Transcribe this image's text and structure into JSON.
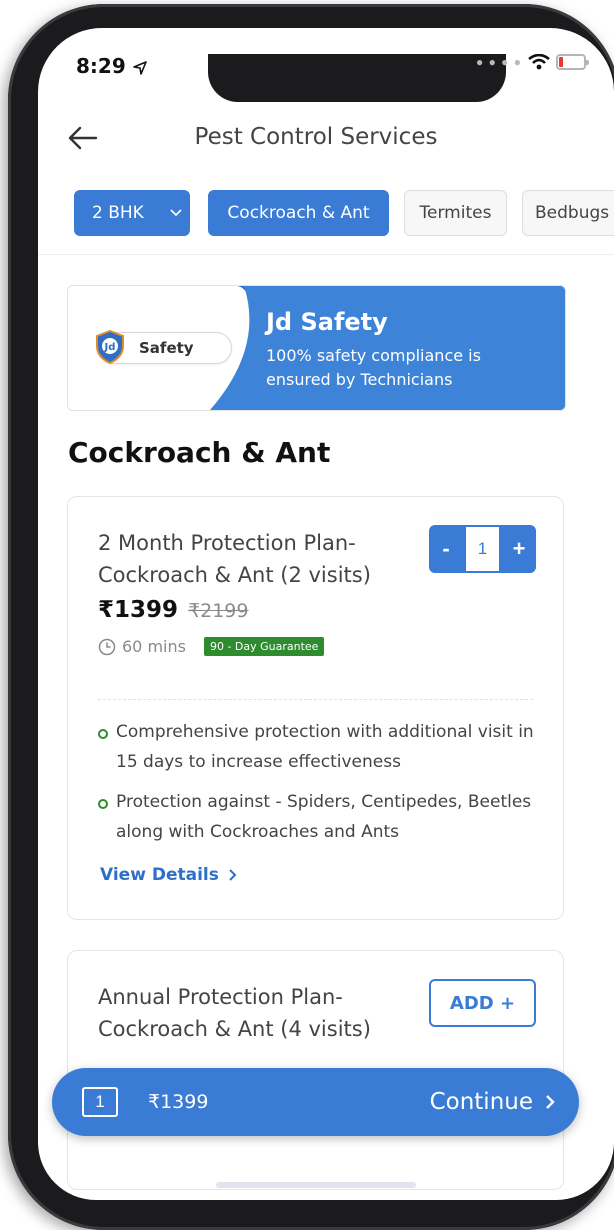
{
  "status_bar": {
    "time": "8:29"
  },
  "header": {
    "title": "Pest Control Services"
  },
  "filters": {
    "property_type": "2 BHK",
    "chips": [
      "Cockroach & Ant",
      "Termites",
      "Bedbugs"
    ]
  },
  "safety_banner": {
    "badge_label": "Safety",
    "badge_logo_text": "Jd",
    "title": "Jd Safety",
    "subtitle": "100% safety compliance is ensured by Technicians"
  },
  "section": {
    "heading": "Cockroach & Ant"
  },
  "plans": [
    {
      "name": "2 Month Protection Plan- Cockroach & Ant (2 visits)",
      "price": "₹1399",
      "mrp": "₹2199",
      "duration": "60 mins",
      "guarantee": "90 - Day Guarantee",
      "quantity": "1",
      "qty_minus": "-",
      "qty_plus": "+",
      "benefits": [
        "Comprehensive protection with additional visit in 15 days to increase effectiveness",
        "Protection against - Spiders, Centipedes, Beetles along with Cockroaches and Ants"
      ],
      "view_details": "View Details"
    },
    {
      "name": "Annual Protection Plan- Cockroach & Ant (4 visits)",
      "add_label": "ADD +"
    }
  ],
  "cart": {
    "count": "1",
    "total": "₹1399",
    "continue_label": "Continue"
  },
  "colors": {
    "primary": "#3a7bd5",
    "guarantee": "#2e8b2e"
  }
}
